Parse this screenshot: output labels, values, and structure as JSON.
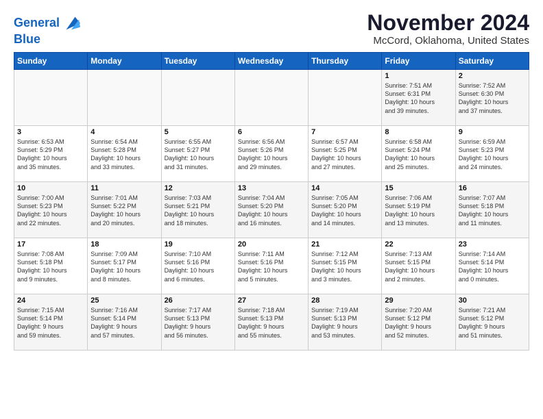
{
  "logo": {
    "line1": "General",
    "line2": "Blue"
  },
  "title": "November 2024",
  "location": "McCord, Oklahoma, United States",
  "days_of_week": [
    "Sunday",
    "Monday",
    "Tuesday",
    "Wednesday",
    "Thursday",
    "Friday",
    "Saturday"
  ],
  "weeks": [
    [
      {
        "num": "",
        "info": ""
      },
      {
        "num": "",
        "info": ""
      },
      {
        "num": "",
        "info": ""
      },
      {
        "num": "",
        "info": ""
      },
      {
        "num": "",
        "info": ""
      },
      {
        "num": "1",
        "info": "Sunrise: 7:51 AM\nSunset: 6:31 PM\nDaylight: 10 hours\nand 39 minutes."
      },
      {
        "num": "2",
        "info": "Sunrise: 7:52 AM\nSunset: 6:30 PM\nDaylight: 10 hours\nand 37 minutes."
      }
    ],
    [
      {
        "num": "3",
        "info": "Sunrise: 6:53 AM\nSunset: 5:29 PM\nDaylight: 10 hours\nand 35 minutes."
      },
      {
        "num": "4",
        "info": "Sunrise: 6:54 AM\nSunset: 5:28 PM\nDaylight: 10 hours\nand 33 minutes."
      },
      {
        "num": "5",
        "info": "Sunrise: 6:55 AM\nSunset: 5:27 PM\nDaylight: 10 hours\nand 31 minutes."
      },
      {
        "num": "6",
        "info": "Sunrise: 6:56 AM\nSunset: 5:26 PM\nDaylight: 10 hours\nand 29 minutes."
      },
      {
        "num": "7",
        "info": "Sunrise: 6:57 AM\nSunset: 5:25 PM\nDaylight: 10 hours\nand 27 minutes."
      },
      {
        "num": "8",
        "info": "Sunrise: 6:58 AM\nSunset: 5:24 PM\nDaylight: 10 hours\nand 25 minutes."
      },
      {
        "num": "9",
        "info": "Sunrise: 6:59 AM\nSunset: 5:23 PM\nDaylight: 10 hours\nand 24 minutes."
      }
    ],
    [
      {
        "num": "10",
        "info": "Sunrise: 7:00 AM\nSunset: 5:23 PM\nDaylight: 10 hours\nand 22 minutes."
      },
      {
        "num": "11",
        "info": "Sunrise: 7:01 AM\nSunset: 5:22 PM\nDaylight: 10 hours\nand 20 minutes."
      },
      {
        "num": "12",
        "info": "Sunrise: 7:03 AM\nSunset: 5:21 PM\nDaylight: 10 hours\nand 18 minutes."
      },
      {
        "num": "13",
        "info": "Sunrise: 7:04 AM\nSunset: 5:20 PM\nDaylight: 10 hours\nand 16 minutes."
      },
      {
        "num": "14",
        "info": "Sunrise: 7:05 AM\nSunset: 5:20 PM\nDaylight: 10 hours\nand 14 minutes."
      },
      {
        "num": "15",
        "info": "Sunrise: 7:06 AM\nSunset: 5:19 PM\nDaylight: 10 hours\nand 13 minutes."
      },
      {
        "num": "16",
        "info": "Sunrise: 7:07 AM\nSunset: 5:18 PM\nDaylight: 10 hours\nand 11 minutes."
      }
    ],
    [
      {
        "num": "17",
        "info": "Sunrise: 7:08 AM\nSunset: 5:18 PM\nDaylight: 10 hours\nand 9 minutes."
      },
      {
        "num": "18",
        "info": "Sunrise: 7:09 AM\nSunset: 5:17 PM\nDaylight: 10 hours\nand 8 minutes."
      },
      {
        "num": "19",
        "info": "Sunrise: 7:10 AM\nSunset: 5:16 PM\nDaylight: 10 hours\nand 6 minutes."
      },
      {
        "num": "20",
        "info": "Sunrise: 7:11 AM\nSunset: 5:16 PM\nDaylight: 10 hours\nand 5 minutes."
      },
      {
        "num": "21",
        "info": "Sunrise: 7:12 AM\nSunset: 5:15 PM\nDaylight: 10 hours\nand 3 minutes."
      },
      {
        "num": "22",
        "info": "Sunrise: 7:13 AM\nSunset: 5:15 PM\nDaylight: 10 hours\nand 2 minutes."
      },
      {
        "num": "23",
        "info": "Sunrise: 7:14 AM\nSunset: 5:14 PM\nDaylight: 10 hours\nand 0 minutes."
      }
    ],
    [
      {
        "num": "24",
        "info": "Sunrise: 7:15 AM\nSunset: 5:14 PM\nDaylight: 9 hours\nand 59 minutes."
      },
      {
        "num": "25",
        "info": "Sunrise: 7:16 AM\nSunset: 5:14 PM\nDaylight: 9 hours\nand 57 minutes."
      },
      {
        "num": "26",
        "info": "Sunrise: 7:17 AM\nSunset: 5:13 PM\nDaylight: 9 hours\nand 56 minutes."
      },
      {
        "num": "27",
        "info": "Sunrise: 7:18 AM\nSunset: 5:13 PM\nDaylight: 9 hours\nand 55 minutes."
      },
      {
        "num": "28",
        "info": "Sunrise: 7:19 AM\nSunset: 5:13 PM\nDaylight: 9 hours\nand 53 minutes."
      },
      {
        "num": "29",
        "info": "Sunrise: 7:20 AM\nSunset: 5:12 PM\nDaylight: 9 hours\nand 52 minutes."
      },
      {
        "num": "30",
        "info": "Sunrise: 7:21 AM\nSunset: 5:12 PM\nDaylight: 9 hours\nand 51 minutes."
      }
    ]
  ]
}
